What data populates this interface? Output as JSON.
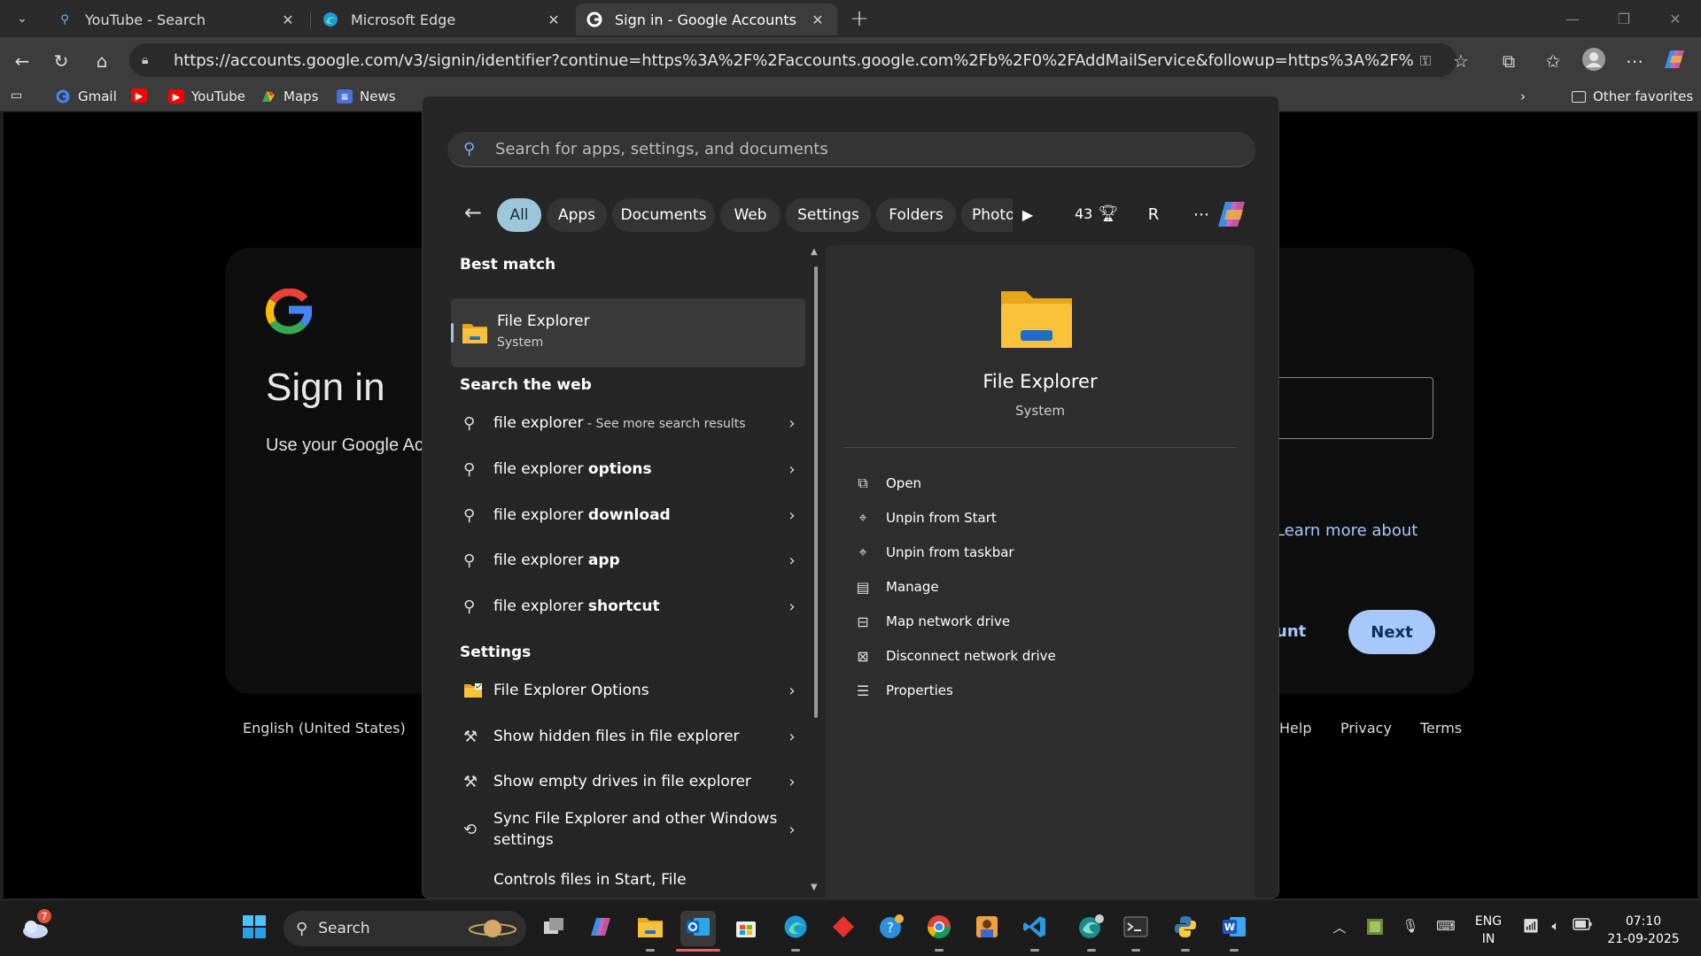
{
  "browser": {
    "tabs": [
      {
        "title": "YouTube - Search",
        "active": false
      },
      {
        "title": "Microsoft Edge",
        "active": false
      },
      {
        "title": "Sign in - Google Accounts",
        "active": true
      }
    ],
    "url": "https://accounts.google.com/v3/signin/identifier?continue=https%3A%2F%2Faccounts.google.com%2Fb%2F0%2FAddMailService&followup=https%3A%2F%2Faccounts.google.co...",
    "bookmarks": [
      {
        "label": "Gmail",
        "icon": "gmail-icon"
      },
      {
        "label": "",
        "icon": "youtube-icon"
      },
      {
        "label": "YouTube",
        "icon": "youtube-icon"
      },
      {
        "label": "Maps",
        "icon": "maps-icon"
      },
      {
        "label": "News",
        "icon": "news-icon"
      }
    ],
    "other_favorites": "Other favorites"
  },
  "google_page": {
    "logo": "G",
    "title": "Sign in",
    "subtitle": "Use your Google Ac",
    "learn_more": "Learn more about",
    "create_account": "unt",
    "next_button": "Next",
    "language": "English (United States)",
    "footer_help": "Help",
    "footer_privacy": "Privacy",
    "footer_terms": "Terms"
  },
  "start_search": {
    "placeholder": "Search for apps, settings, and documents",
    "filters": [
      "All",
      "Apps",
      "Documents",
      "Web",
      "Settings",
      "Folders",
      "Photo"
    ],
    "active_filter": "All",
    "points": "43",
    "avatar_initial": "R",
    "best_match_heading": "Best match",
    "best_match": {
      "name": "File Explorer",
      "type": "System"
    },
    "web_heading": "Search the web",
    "web_results": [
      {
        "prefix": "file explorer",
        "bold": "",
        "suffix": " - See more search results"
      },
      {
        "prefix": "file explorer ",
        "bold": "options",
        "suffix": ""
      },
      {
        "prefix": "file explorer ",
        "bold": "download",
        "suffix": ""
      },
      {
        "prefix": "file explorer ",
        "bold": "app",
        "suffix": ""
      },
      {
        "prefix": "file explorer ",
        "bold": "shortcut",
        "suffix": ""
      }
    ],
    "settings_heading": "Settings",
    "settings_results": [
      "File Explorer Options",
      "Show hidden files in file explorer",
      "Show empty drives in file explorer",
      "Sync File Explorer and other Windows settings",
      "Controls files in Start, File"
    ],
    "preview": {
      "name": "File Explorer",
      "type": "System",
      "actions": [
        {
          "label": "Open",
          "icon": "open-external-icon"
        },
        {
          "label": "Unpin from Start",
          "icon": "unpin-icon"
        },
        {
          "label": "Unpin from taskbar",
          "icon": "unpin-icon"
        },
        {
          "label": "Manage",
          "icon": "manage-icon"
        },
        {
          "label": "Map network drive",
          "icon": "network-drive-icon"
        },
        {
          "label": "Disconnect network drive",
          "icon": "disconnect-drive-icon"
        },
        {
          "label": "Properties",
          "icon": "properties-icon"
        }
      ]
    }
  },
  "taskbar": {
    "weather_badge": "7",
    "search_label": "Search",
    "language_line1": "ENG",
    "language_line2": "IN",
    "time": "07:10",
    "date": "21-09-2025"
  },
  "colors": {
    "accent": "#9cc7d9",
    "google_blue": "#a8c7fa",
    "panel_bg": "#262626"
  }
}
